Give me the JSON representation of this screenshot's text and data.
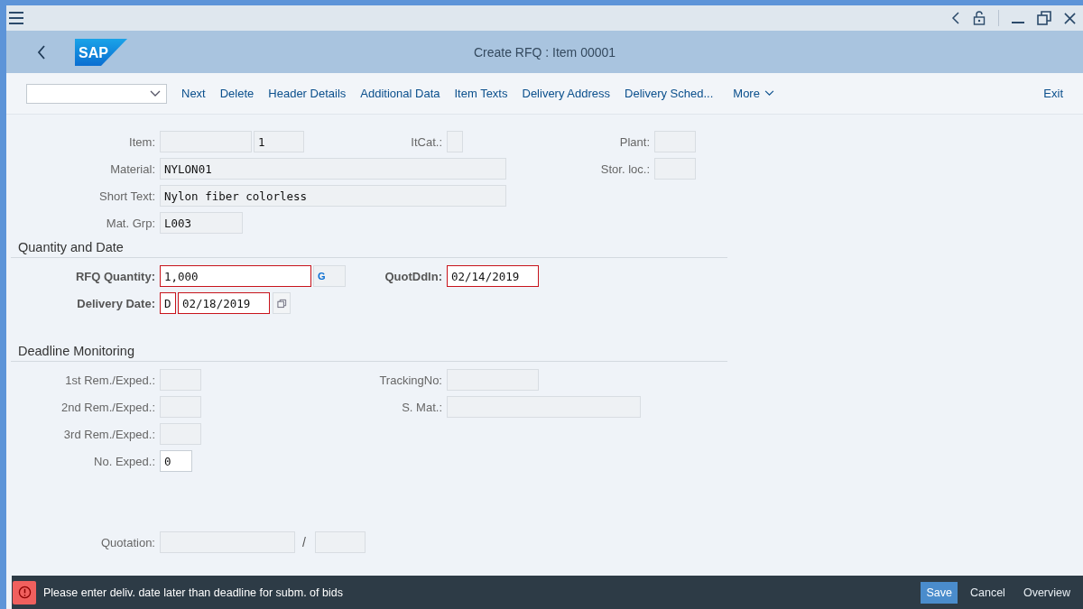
{
  "shell": {
    "logo": "SAP",
    "title": "Create RFQ : Item 00001"
  },
  "toolbar": {
    "actions": [
      "Next",
      "Delete",
      "Header Details",
      "Additional Data",
      "Item Texts",
      "Delivery Address",
      "Delivery Sched..."
    ],
    "more": "More",
    "exit": "Exit"
  },
  "header": {
    "rows": [
      {
        "left": {
          "label": "Item:",
          "required": false,
          "fields": [
            {
              "disabled": true,
              "error": false
            },
            {
              "value": "1",
              "disabled": true,
              "error": false
            }
          ]
        },
        "middle": {
          "label": "ItCat.:",
          "required": false,
          "fields": [
            {
              "disabled": true,
              "error": false
            }
          ]
        },
        "right": {
          "label": "Plant:",
          "required": false,
          "fields": [
            {
              "disabled": true,
              "error": false
            }
          ]
        }
      },
      {
        "left": {
          "label": "Material:",
          "required": false,
          "fields": [
            {
              "value": "NYLON01",
              "disabled": true,
              "error": false
            }
          ]
        },
        "right": {
          "label": "Stor. loc.:",
          "required": false,
          "fields": [
            {
              "disabled": true,
              "error": false
            }
          ]
        }
      },
      {
        "left": {
          "label": "Short Text:",
          "required": false,
          "fields": [
            {
              "value": "Nylon fiber colorless",
              "disabled": true,
              "error": false
            }
          ]
        }
      },
      {
        "left": {
          "label": "Mat. Grp:",
          "required": false,
          "fields": [
            {
              "value": "L003",
              "disabled": true,
              "error": false
            }
          ]
        }
      }
    ]
  },
  "quantity": {
    "title": "Quantity and Date",
    "rows": [
      {
        "left": {
          "label": "RFQ Quantity:",
          "required": true,
          "fields": [
            {
              "value": "1,000",
              "disabled": false,
              "error": true
            },
            {
              "value": "G",
              "disabled": true,
              "error": false
            }
          ]
        },
        "middle": {
          "label": "QuotDdln:",
          "required": true,
          "fields": [
            {
              "value": "02/14/2019",
              "disabled": false,
              "error": true
            }
          ]
        }
      },
      {
        "left": {
          "label": "Delivery Date:",
          "required": true,
          "help_button": true,
          "fields": [
            {
              "value": "D",
              "disabled": false,
              "error": true
            },
            {
              "value": "02/18/2019",
              "disabled": false,
              "error": true
            }
          ]
        }
      }
    ]
  },
  "deadline": {
    "title": "Deadline Monitoring",
    "rows": [
      {
        "left": {
          "label": "1st Rem./Exped.:",
          "required": false,
          "fields": [
            {
              "disabled": true,
              "error": false
            }
          ]
        },
        "middle": {
          "label": "TrackingNo:",
          "required": false,
          "fields": [
            {
              "disabled": true,
              "error": false
            }
          ]
        }
      },
      {
        "left": {
          "label": "2nd Rem./Exped.:",
          "required": false,
          "fields": [
            {
              "disabled": true,
              "error": false
            }
          ]
        },
        "middle": {
          "label": "S. Mat.:",
          "required": false,
          "fields": [
            {
              "disabled": true,
              "error": false
            }
          ]
        }
      },
      {
        "left": {
          "label": "3rd Rem./Exped.:",
          "required": false,
          "fields": [
            {
              "disabled": true,
              "error": false
            }
          ]
        }
      },
      {
        "left": {
          "label": "No. Exped.:",
          "required": false,
          "fields": [
            {
              "value": "0",
              "disabled": false,
              "error": false
            }
          ]
        }
      }
    ]
  },
  "quotation": {
    "label": "Quotation:",
    "separator": "/",
    "fields": [
      {
        "disabled": true,
        "error": false
      },
      {
        "disabled": true,
        "error": false
      }
    ]
  },
  "message_bar": {
    "kind": "error",
    "text": "Please enter deliv. date later than deadline for subm. of bids",
    "buttons": [
      {
        "label": "Save",
        "primary": true
      },
      {
        "label": "Cancel",
        "primary": false
      },
      {
        "label": "Overview",
        "primary": false
      }
    ]
  }
}
